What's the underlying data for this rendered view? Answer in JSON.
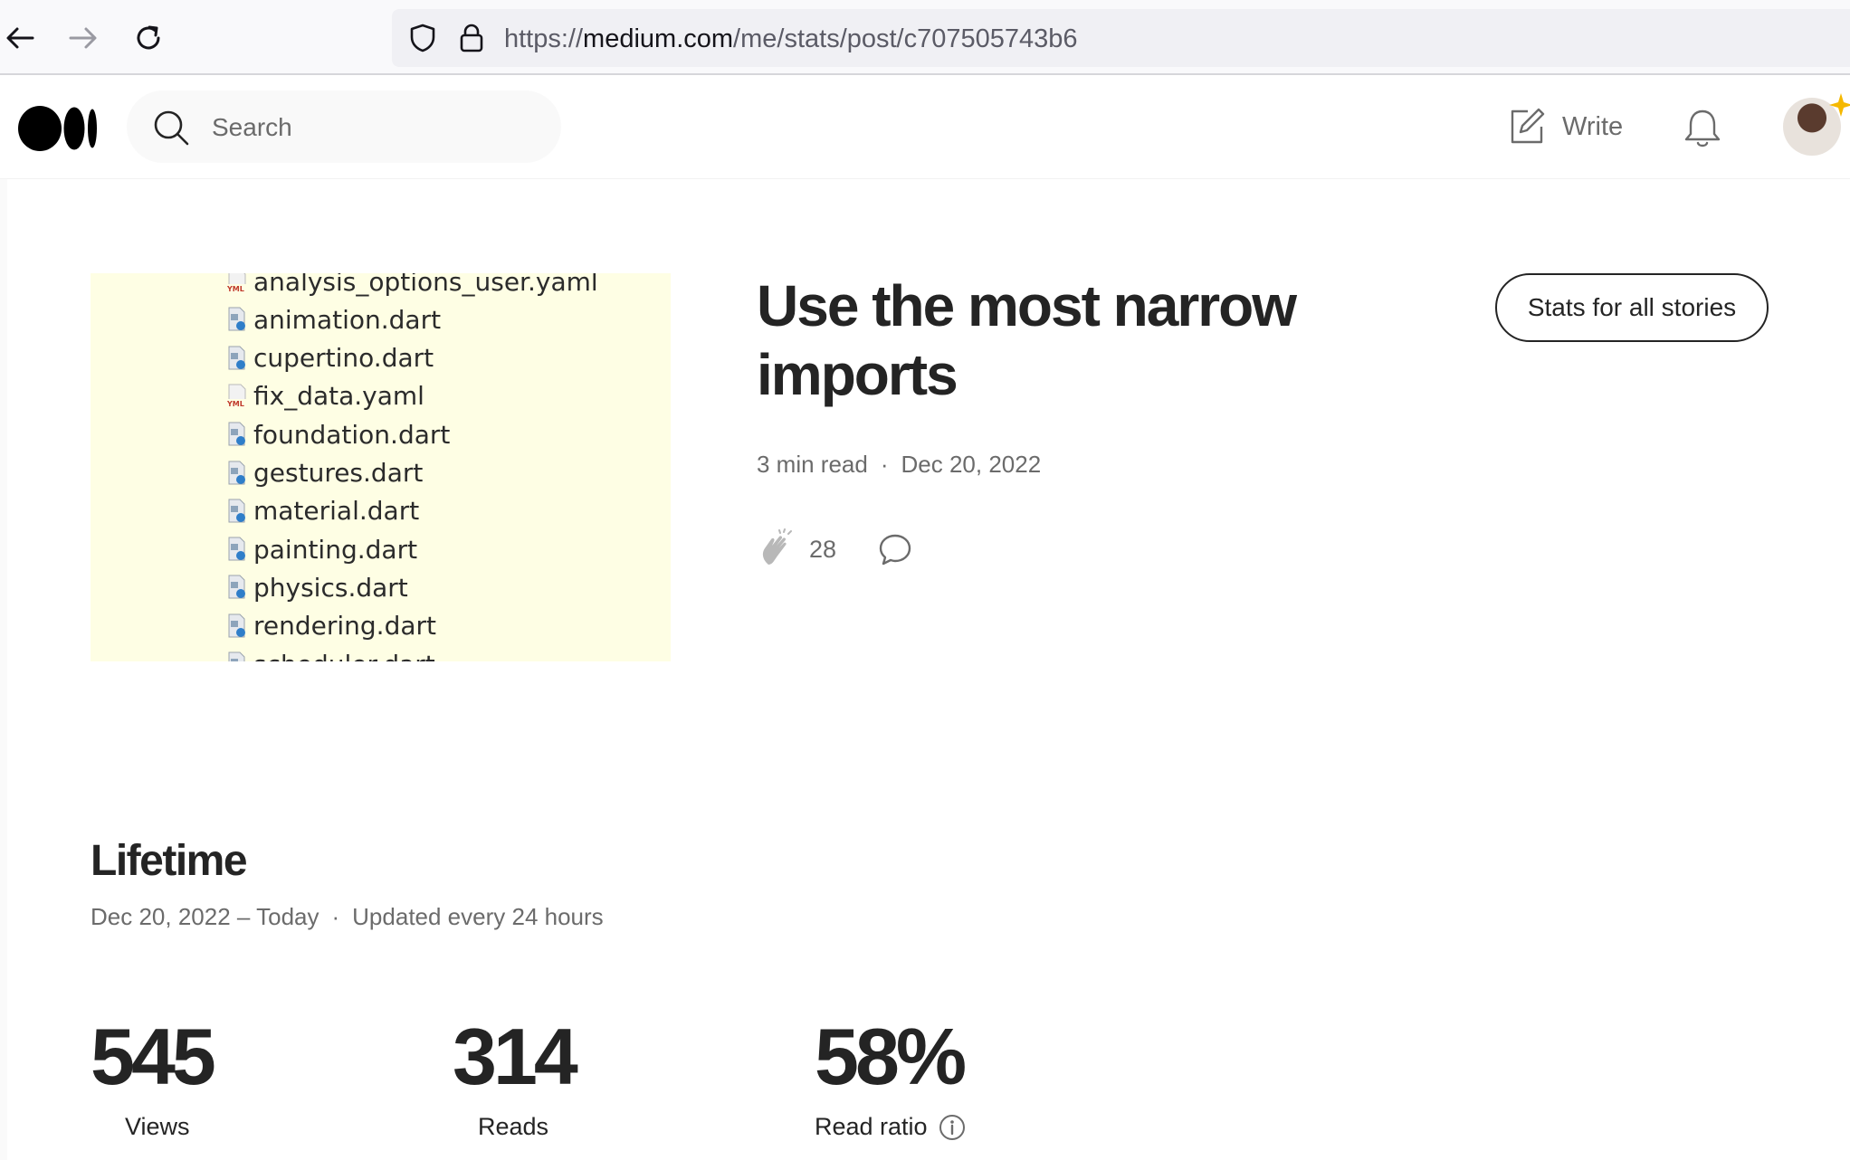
{
  "browser": {
    "url_scheme": "https://",
    "url_host": "medium.com",
    "url_path": "/me/stats/post/c707505743b6"
  },
  "header": {
    "search_placeholder": "Search",
    "write_label": "Write"
  },
  "thumbnail": {
    "files": [
      {
        "name": "analysis_options_user.yaml",
        "type": "yaml"
      },
      {
        "name": "animation.dart",
        "type": "dart"
      },
      {
        "name": "cupertino.dart",
        "type": "dart"
      },
      {
        "name": "fix_data.yaml",
        "type": "yaml"
      },
      {
        "name": "foundation.dart",
        "type": "dart"
      },
      {
        "name": "gestures.dart",
        "type": "dart"
      },
      {
        "name": "material.dart",
        "type": "dart"
      },
      {
        "name": "painting.dart",
        "type": "dart"
      },
      {
        "name": "physics.dart",
        "type": "dart"
      },
      {
        "name": "rendering.dart",
        "type": "dart"
      },
      {
        "name": "scheduler.dart",
        "type": "dart"
      }
    ]
  },
  "story": {
    "title": "Use the most narrow imports",
    "read_time": "3 min read",
    "separator": "·",
    "date": "Dec 20, 2022",
    "claps": "28",
    "stats_all_label": "Stats for all stories"
  },
  "lifetime": {
    "title": "Lifetime",
    "range": "Dec 20, 2022 – Today",
    "separator": "·",
    "update_note": "Updated every 24 hours",
    "views_value": "545",
    "views_label": "Views",
    "reads_value": "314",
    "reads_label": "Reads",
    "ratio_value": "58%",
    "ratio_label": "Read ratio"
  },
  "icons": {
    "back": "arrow-left-icon",
    "forward": "arrow-right-icon",
    "reload": "reload-icon",
    "shield": "shield-icon",
    "lock": "lock-icon",
    "logo": "medium-logo-icon",
    "search": "search-icon",
    "write": "write-icon",
    "bell": "bell-icon",
    "clap": "clap-icon",
    "comment": "comment-icon",
    "info": "info-icon"
  },
  "colors": {
    "text_primary": "#242424",
    "text_secondary": "#6b6b6b",
    "thumbnail_bg": "#fefee4",
    "browser_bar": "#f9f9fb"
  }
}
